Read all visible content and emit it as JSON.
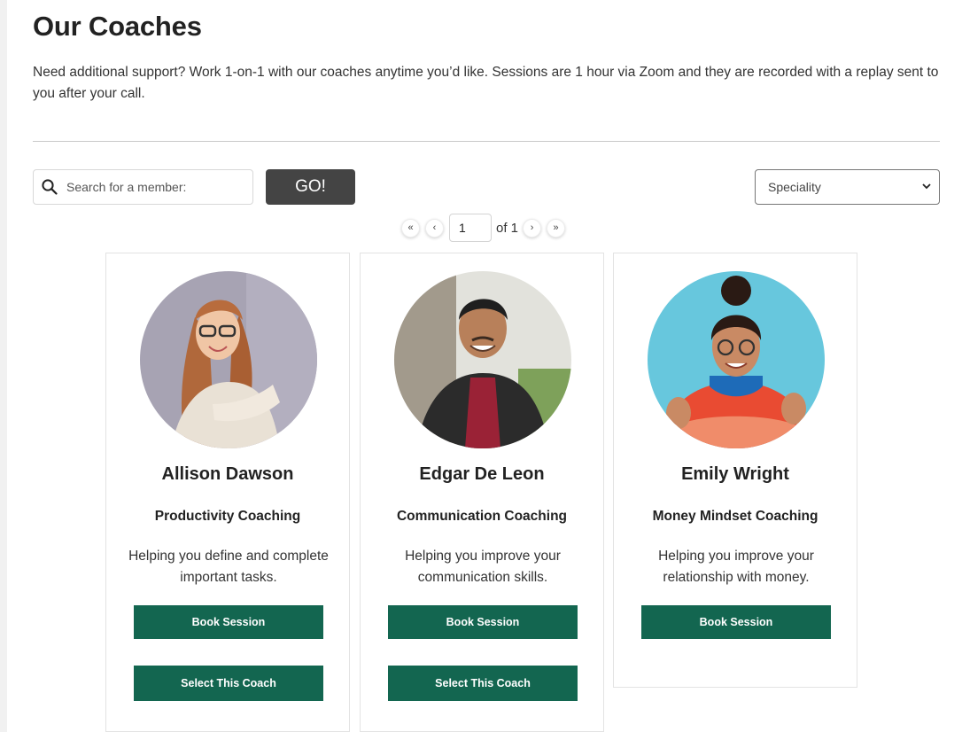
{
  "page": {
    "title": "Our Coaches",
    "intro": "Need additional support? Work 1-on-1 with our coaches anytime you’d like. Sessions are 1 hour via Zoom and they are recorded with a replay sent to you after your call."
  },
  "search": {
    "placeholder": "Search for a member:",
    "value": "",
    "go_label": "GO!"
  },
  "filter": {
    "selected": "Speciality"
  },
  "pagination": {
    "first": "«",
    "prev": "‹",
    "current": "1",
    "of_label": "of 1",
    "next": "›",
    "last": "»"
  },
  "coaches": [
    {
      "name": "Allison Dawson",
      "specialty": "Productivity Coaching",
      "description": "Helping you define and complete important tasks.",
      "book_label": "Book Session",
      "select_label": "Select This Coach"
    },
    {
      "name": "Edgar De Leon",
      "specialty": "Communication Coaching",
      "description": "Helping you improve your communication skills.",
      "book_label": "Book Session",
      "select_label": "Select This Coach"
    },
    {
      "name": "Emily Wright",
      "specialty": "Money Mindset Coaching",
      "description": "Helping you improve your relationship with money.",
      "book_label": "Book Session"
    }
  ],
  "icons": {
    "search": "search-icon",
    "dropdown": "chevron-down-icon"
  },
  "colors": {
    "accent_green": "#136650",
    "go_button": "#444444"
  }
}
